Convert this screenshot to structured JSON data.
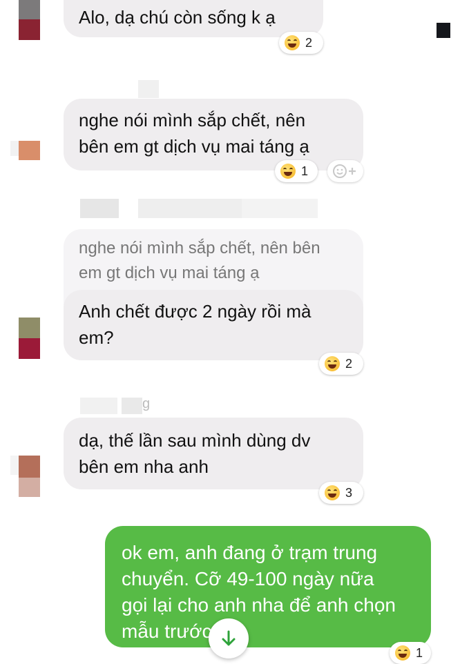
{
  "messages": [
    {
      "id": "m1",
      "lines": [
        "Alo, dạ chú còn sống k ạ"
      ],
      "reaction_count": "2"
    },
    {
      "id": "m2",
      "lines": [
        "nghe nói mình sắp chết, nên",
        "bên em gt dịch vụ mai táng ạ"
      ],
      "reaction_count": "1"
    },
    {
      "id": "m3",
      "quoted_lines": [
        "nghe nói mình sắp chết, nên bên",
        "em gt dịch vụ mai táng ạ"
      ],
      "lines": [
        "Anh chết được 2 ngày rồi mà",
        "em?"
      ],
      "reaction_count": "2"
    },
    {
      "id": "m4",
      "lines": [
        "dạ, thế lần sau mình dùng dv",
        "bên em nha anh"
      ],
      "reaction_count": "3"
    }
  ],
  "sent_message": {
    "lines": [
      "ok em, anh đang ở trạm trung",
      "chuyển. Cỡ 49-100 ngày nữa",
      "gọi lại cho anh nha để anh chọn",
      "mẫu trước"
    ],
    "reaction_count": "1"
  },
  "blurred_sender_label_fragment": "g",
  "icons": {
    "reaction": "laughing-emoji-icon",
    "add_reaction": "add-reaction-icon",
    "scroll": "arrow-down-icon"
  },
  "colors": {
    "incoming_bubble": "#efedef",
    "outgoing_bubble": "#57bb46",
    "accent": "#2ea33a"
  }
}
